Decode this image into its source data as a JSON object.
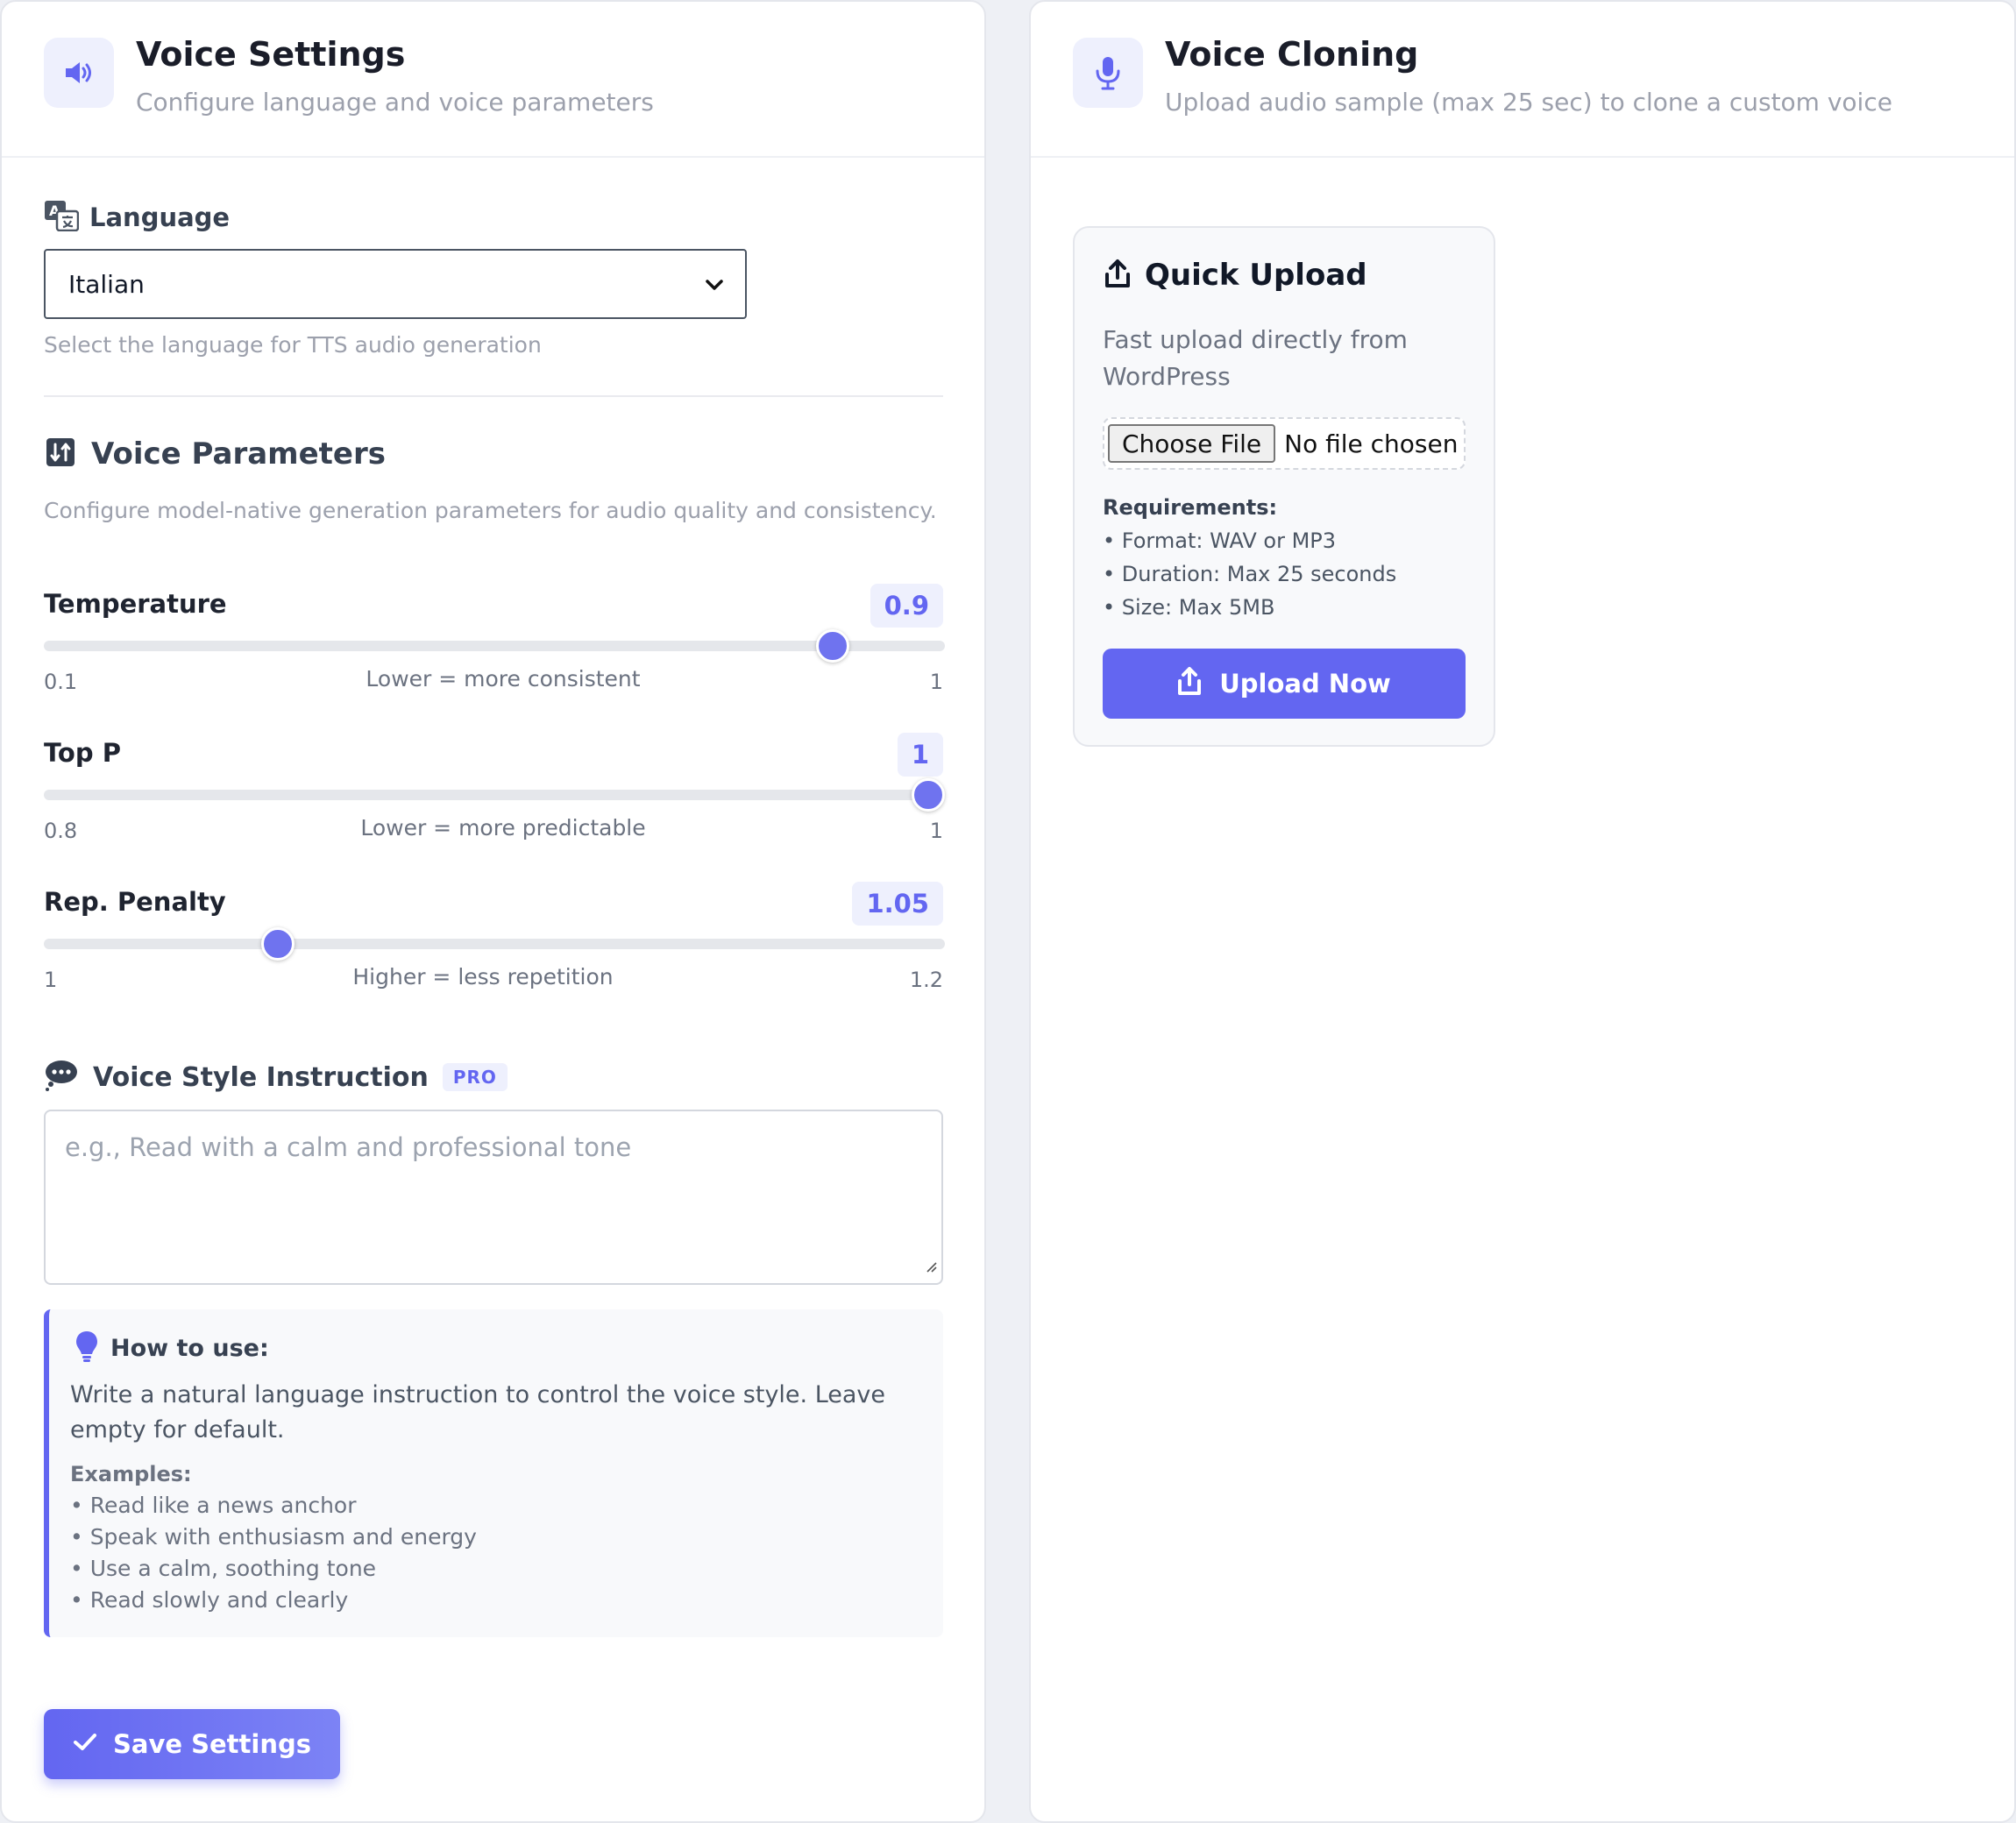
{
  "voice_settings": {
    "title": "Voice Settings",
    "subtitle": "Configure language and voice parameters",
    "icon": "speaker-icon",
    "language": {
      "label": "Language",
      "selected": "Italian",
      "hint": "Select the language for TTS audio generation"
    },
    "parameters": {
      "title": "Voice Parameters",
      "description": "Configure model-native generation parameters for audio quality and consistency.",
      "sliders": [
        {
          "name": "Temperature",
          "value": "0.9",
          "min": "0.1",
          "max": "1",
          "hint": "Lower = more consistent",
          "level": 0.889
        },
        {
          "name": "Top P",
          "value": "1",
          "min": "0.8",
          "max": "1",
          "hint": "Lower = more predictable",
          "level": 1.0
        },
        {
          "name": "Rep. Penalty",
          "value": "1.05",
          "min": "1",
          "max": "1.2",
          "hint": "Higher = less repetition",
          "level": 0.25
        }
      ]
    },
    "style_instruction": {
      "label": "Voice Style Instruction",
      "badge": "PRO",
      "placeholder": "e.g., Read with a calm and professional tone"
    },
    "how_to": {
      "title": "How to use:",
      "text": "Write a natural language instruction to control the voice style. Leave empty for default.",
      "examples_title": "Examples:",
      "examples": [
        "• Read like a news anchor",
        "• Speak with enthusiasm and energy",
        "• Use a calm, soothing tone",
        "• Read slowly and clearly"
      ]
    },
    "save_label": "Save Settings"
  },
  "voice_cloning": {
    "title": "Voice Cloning",
    "subtitle": "Upload audio sample (max 25 sec) to clone a custom voice",
    "icon": "microphone-icon",
    "quick_upload": {
      "title": "Quick Upload",
      "description": "Fast upload directly from WordPress",
      "choose_file_label": "Choose File",
      "no_file_text": "No file chosen",
      "requirements_title": "Requirements:",
      "requirements": [
        "• Format: WAV or MP3",
        "• Duration: Max 25 seconds",
        "• Size: Max 5MB"
      ],
      "upload_label": "Upload Now"
    }
  },
  "colors": {
    "accent": "#6366f1",
    "background": "#eef0f5",
    "panel": "#ffffff"
  }
}
